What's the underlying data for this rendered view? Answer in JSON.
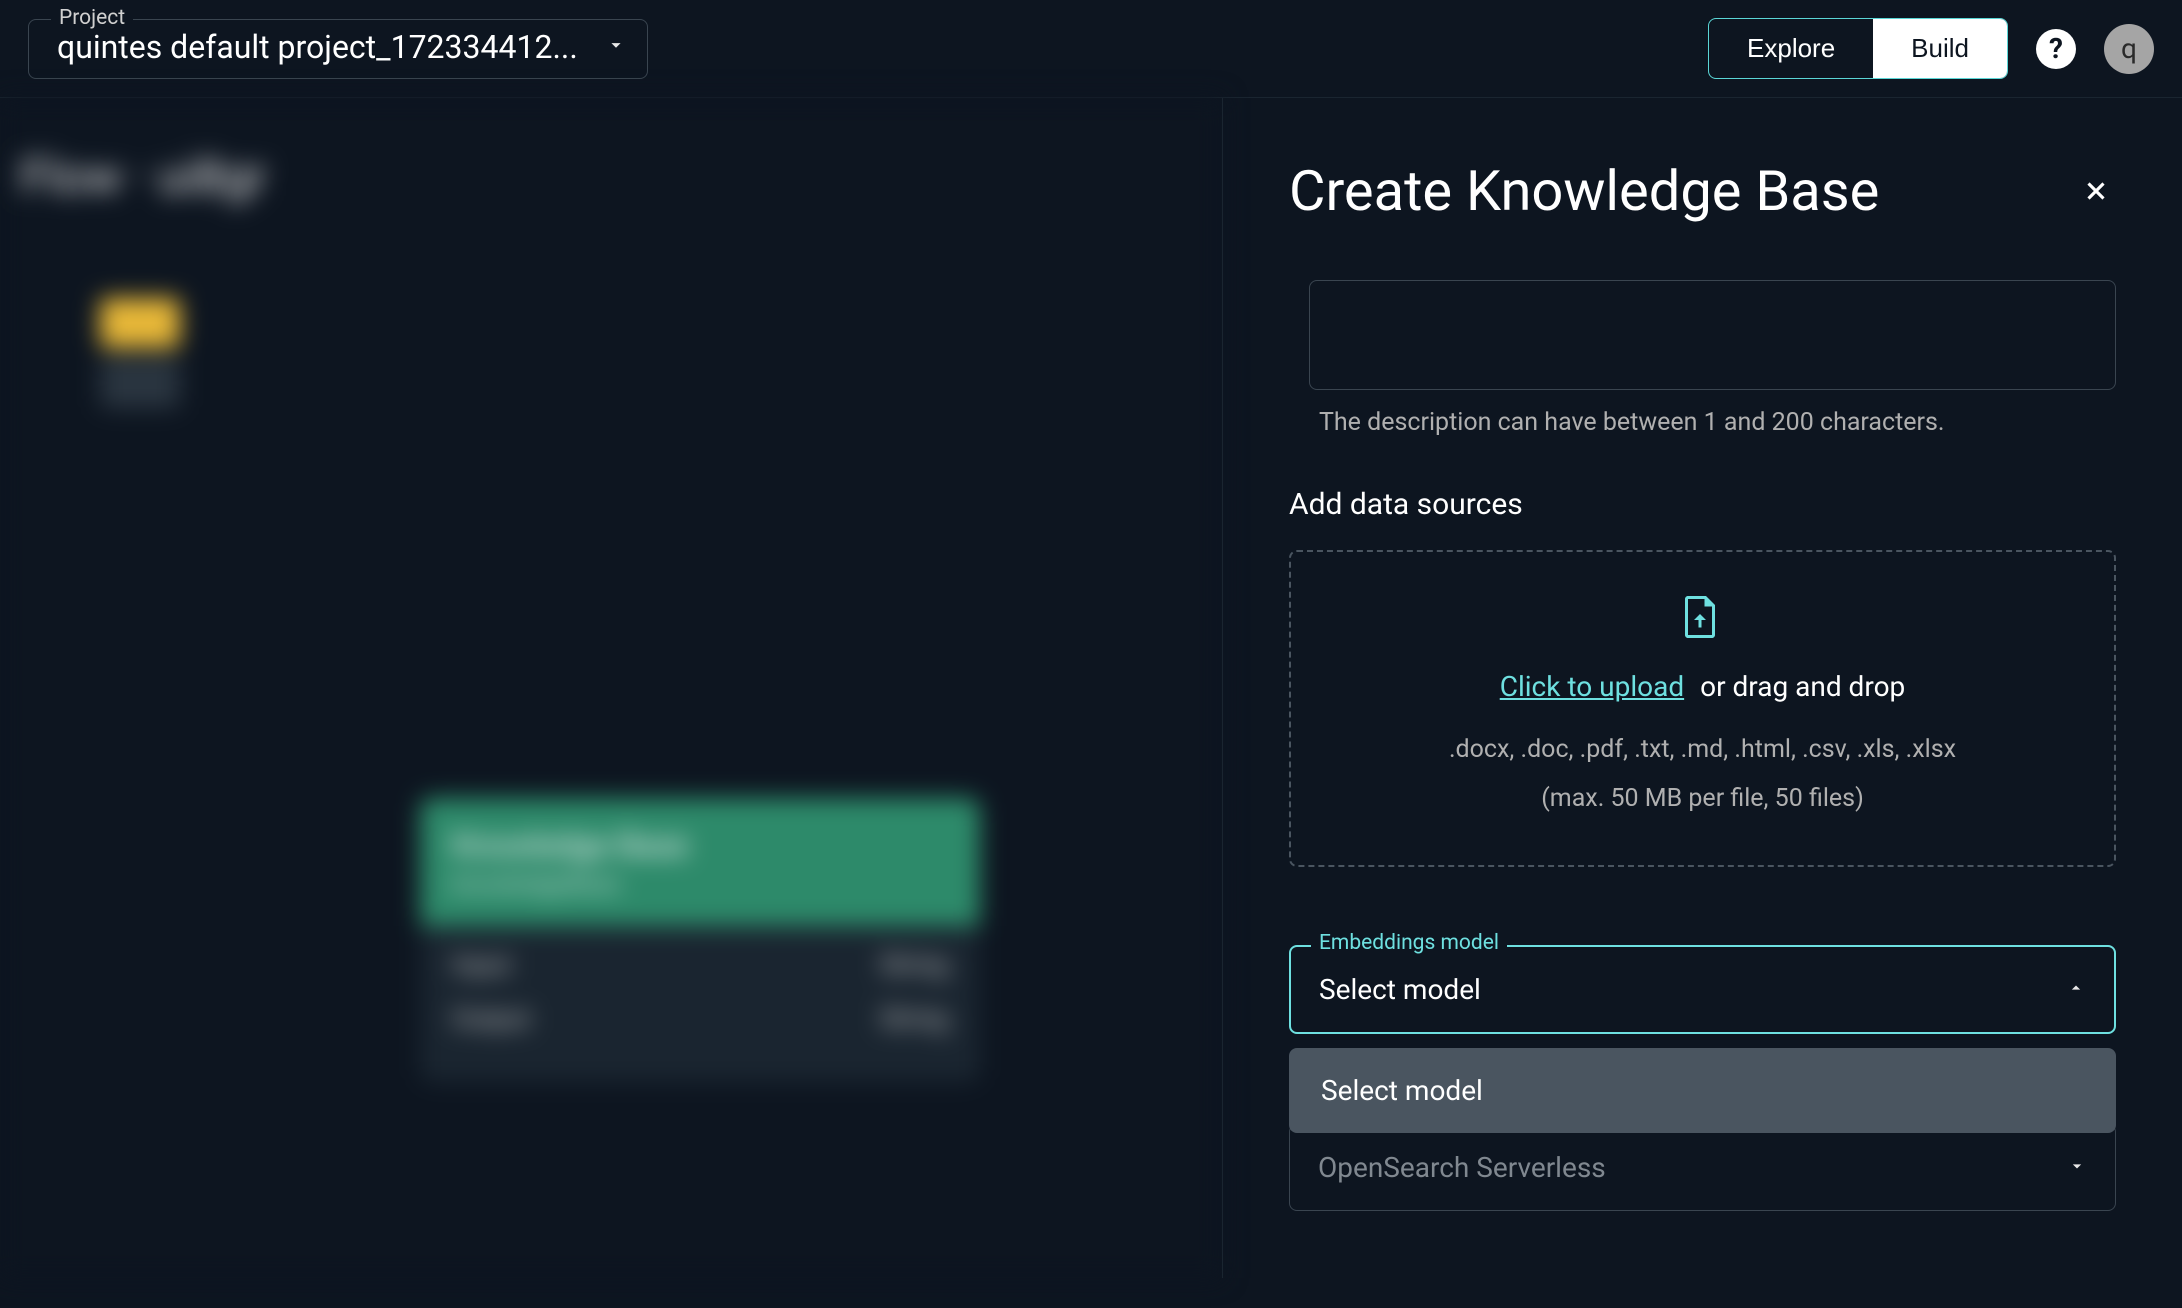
{
  "header": {
    "project_label": "Project",
    "project_value": "quintes default project_172334412...",
    "explore_label": "Explore",
    "build_label": "Build",
    "help_symbol": "?",
    "avatar_letter": "q"
  },
  "canvas": {
    "title_fragment": "Flow · ui8gr",
    "node_header_title": "Knowledge Base",
    "node_header_sub": "knowledgeBase",
    "row1_left": "Input",
    "row1_right": "String",
    "row2_left": "Output",
    "row2_right": "String"
  },
  "panel": {
    "title": "Create Knowledge Base",
    "description_helper": "The description can have between 1 and 200 characters.",
    "data_sources_title": "Add data sources",
    "upload_link": "Click to upload",
    "upload_suffix": "or drag and drop",
    "upload_formats": ".docx, .doc, .pdf, .txt, .md, .html, .csv, .xls, .xlsx",
    "upload_limits": "(max. 50 MB per file, 50 files)",
    "embeddings_label": "Embeddings model",
    "embeddings_value": "Select model",
    "dropdown_option": "Select model",
    "vector_store_value": "OpenSearch Serverless"
  }
}
